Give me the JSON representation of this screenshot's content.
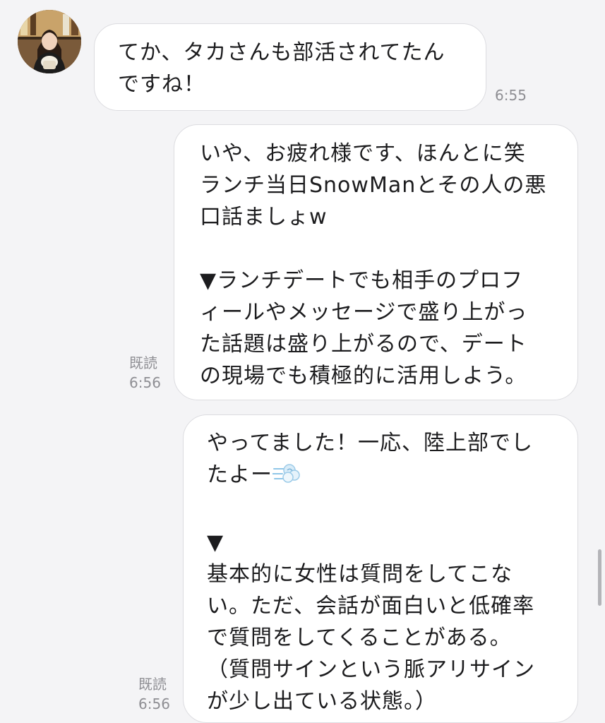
{
  "messages": [
    {
      "direction": "incoming",
      "text": "てか、タカさんも部活されてたん\nですね！",
      "time": "6:55"
    },
    {
      "direction": "outgoing",
      "text": "いや、お疲れ様です、ほんとに笑\nランチ当日SnowManとその人の悪\n口話ましょw\n\n▼ランチデートでも相手のプロフ\nィールやメッセージで盛り上がっ\nた話題は盛り上がるので、デート\nの現場でも積極的に活用しよう。",
      "read_label": "既読",
      "time": "6:56"
    },
    {
      "direction": "outgoing",
      "text_before_emoji": "やってました！一応、陸上部でし\nたよー",
      "emoji": "dash-emoji",
      "text_after_emoji": "▼\n基本的に女性は質問をしてこな\nい。ただ、会話が面白いと低確率\nで質問をしてくることがある。\n（質問サインという脈アリサイン\nが少し出ている状態。）",
      "read_label": "既読",
      "time": "6:56"
    }
  ],
  "colors": {
    "background": "#f4f4f6",
    "bubble": "#ffffff",
    "bubble_border": "#dcdce0",
    "meta_text": "#8e8e93"
  }
}
